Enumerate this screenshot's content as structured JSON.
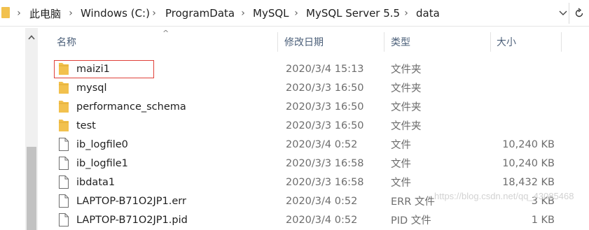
{
  "address_bar": {
    "breadcrumbs": [
      "此电脑",
      "Windows (C:)",
      "ProgramData",
      "MySQL",
      "MySQL Server 5.5",
      "data"
    ],
    "separator": "›"
  },
  "columns": {
    "name": "名称",
    "date_modified": "修改日期",
    "type": "类型",
    "size": "大小"
  },
  "rows": [
    {
      "name": "maizi1",
      "date": "2020/3/4 15:13",
      "type": "文件夹",
      "size": "",
      "kind": "folder",
      "highlighted": true
    },
    {
      "name": "mysql",
      "date": "2020/3/3 16:50",
      "type": "文件夹",
      "size": "",
      "kind": "folder"
    },
    {
      "name": "performance_schema",
      "date": "2020/3/3 16:50",
      "type": "文件夹",
      "size": "",
      "kind": "folder"
    },
    {
      "name": "test",
      "date": "2020/3/3 16:50",
      "type": "文件夹",
      "size": "",
      "kind": "folder"
    },
    {
      "name": "ib_logfile0",
      "date": "2020/3/4 0:52",
      "type": "文件",
      "size": "10,240 KB",
      "kind": "file"
    },
    {
      "name": "ib_logfile1",
      "date": "2020/3/3 16:58",
      "type": "文件",
      "size": "10,240 KB",
      "kind": "file"
    },
    {
      "name": "ibdata1",
      "date": "2020/3/3 16:58",
      "type": "文件",
      "size": "18,432 KB",
      "kind": "file"
    },
    {
      "name": "LAPTOP-B71O2JP1.err",
      "date": "2020/3/4 0:52",
      "type": "ERR 文件",
      "size": "3 KB",
      "kind": "file"
    },
    {
      "name": "LAPTOP-B71O2JP1.pid",
      "date": "2020/3/4 0:52",
      "type": "PID 文件",
      "size": "1 KB",
      "kind": "file"
    }
  ],
  "watermark": "https://blog.csdn.net/qq_43085468",
  "colors": {
    "folder": "#f2c14e",
    "highlight_border": "#e0413a",
    "header_text": "#4c607a"
  },
  "icons": {
    "folder": "folder-icon",
    "file": "file-icon",
    "refresh": "refresh-icon",
    "dropdown": "chevron-down-icon",
    "scroll_up": "scroll-up-arrow-icon",
    "sort": "sort-ascending-icon"
  }
}
